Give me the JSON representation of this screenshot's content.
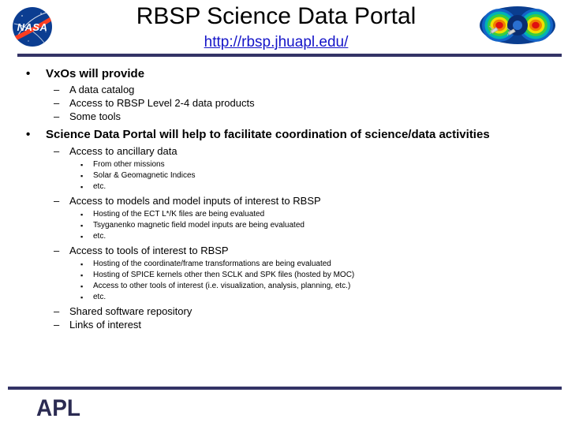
{
  "header": {
    "title": "RBSP Science Data Portal",
    "url": "http://rbsp.jhuapl.edu/",
    "nasa_logo_alt": "NASA",
    "belt_logo_alt": "RBSP radiation belt visualization",
    "rule_color": "#333366",
    "link_color": "#1414c8"
  },
  "content": {
    "bullets": [
      {
        "level": 1,
        "marker": "•",
        "text": "VxOs will provide"
      },
      {
        "level": 2,
        "marker": "–",
        "text": "A data catalog"
      },
      {
        "level": 2,
        "marker": "–",
        "text": "Access to RBSP Level 2-4 data products"
      },
      {
        "level": 2,
        "marker": "–",
        "text": "Some tools"
      },
      {
        "level": 1,
        "marker": "•",
        "text": "Science Data Portal will help to facilitate coordination of science/data activities"
      },
      {
        "level": 2,
        "marker": "–",
        "text": "Access to ancillary data"
      },
      {
        "level": 3,
        "marker": "▪",
        "text": "From other missions"
      },
      {
        "level": 3,
        "marker": "▪",
        "text": "Solar & Geomagnetic Indices"
      },
      {
        "level": 3,
        "marker": "▪",
        "text": "etc."
      },
      {
        "level": 2,
        "marker": "–",
        "text": "Access to models and model inputs of interest to RBSP"
      },
      {
        "level": 3,
        "marker": "▪",
        "text": "Hosting of the ECT L*/K files are being evaluated"
      },
      {
        "level": 3,
        "marker": "▪",
        "text": "Tsyganenko magnetic field model inputs are being evaluated"
      },
      {
        "level": 3,
        "marker": "▪",
        "text": "etc."
      },
      {
        "level": 2,
        "marker": "–",
        "text": "Access to tools of interest to RBSP"
      },
      {
        "level": 3,
        "marker": "▪",
        "text": "Hosting of the coordinate/frame transformations are being evaluated"
      },
      {
        "level": 3,
        "marker": "▪",
        "text": "Hosting of SPICE kernels other then SCLK and SPK files (hosted by MOC)"
      },
      {
        "level": 3,
        "marker": "▪",
        "text": "Access to other tools of interest (i.e. visualization, analysis, planning, etc.)"
      },
      {
        "level": 3,
        "marker": "▪",
        "text": "etc."
      },
      {
        "level": 2,
        "marker": "–",
        "text": "Shared software repository"
      },
      {
        "level": 2,
        "marker": "–",
        "text": "Links of interest"
      }
    ]
  },
  "footer": {
    "logo_text": "APL",
    "logo_color": "#2b2b52",
    "rule_color": "#333366"
  }
}
